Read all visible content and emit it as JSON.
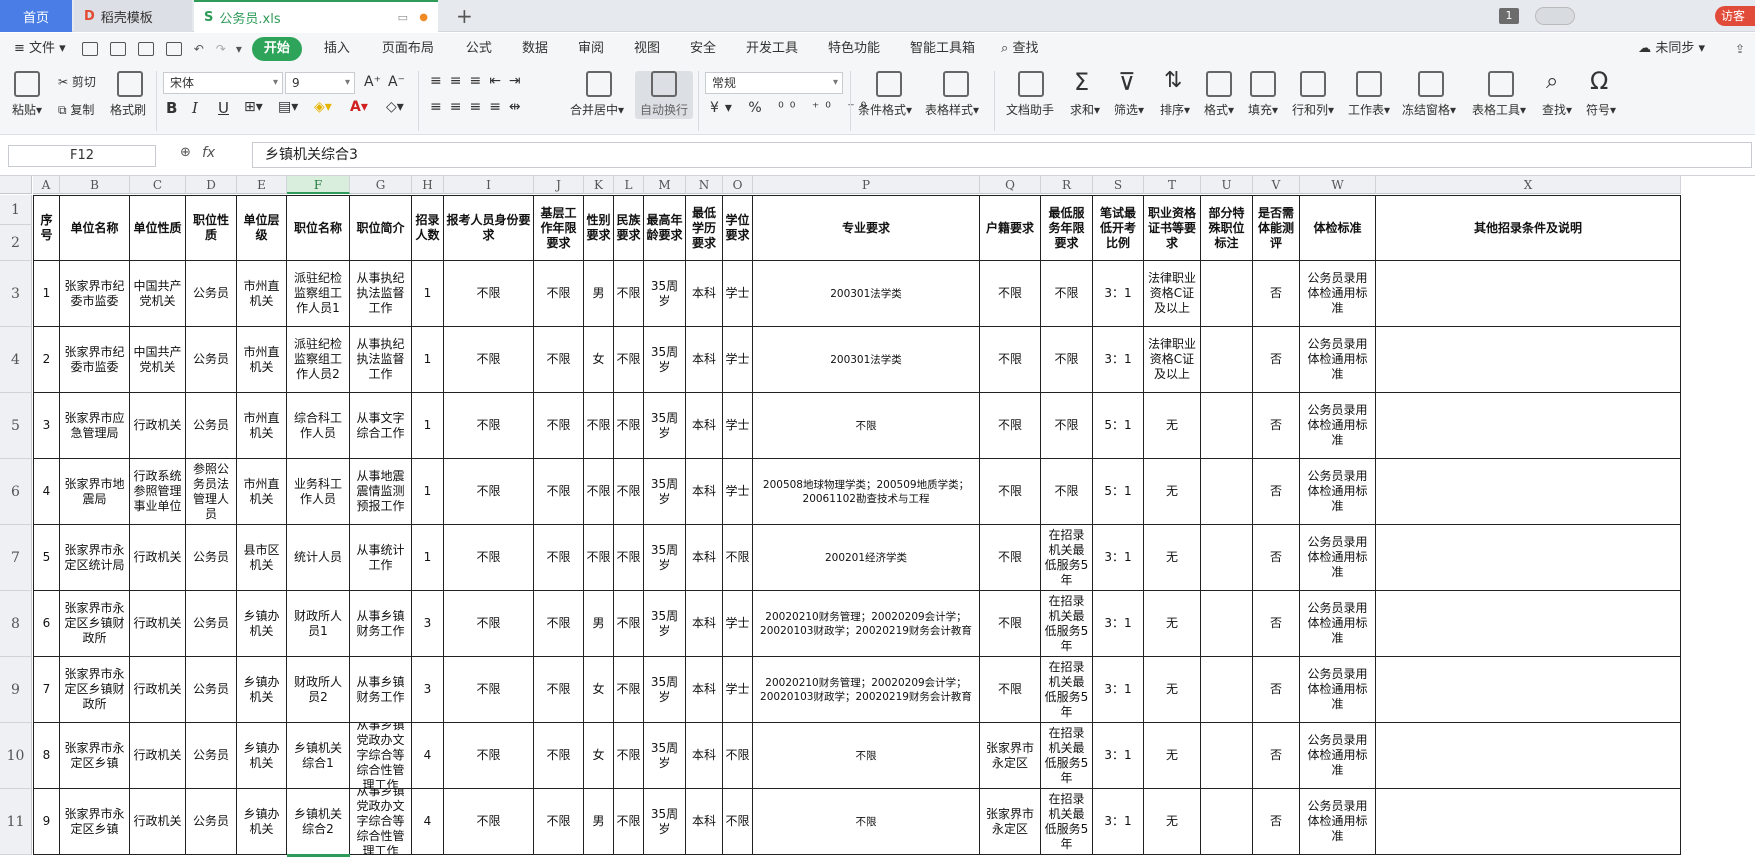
{
  "tabs": {
    "home": "首页",
    "template": "稻壳模板",
    "file": "公务员.xls",
    "badge": "1",
    "user": "访客"
  },
  "menu": {
    "file": "文件",
    "items": [
      "开始",
      "插入",
      "页面布局",
      "公式",
      "数据",
      "审阅",
      "视图",
      "安全",
      "开发工具",
      "特色功能",
      "智能工具箱"
    ],
    "search": "查找",
    "sync": "未同步"
  },
  "ribbon": {
    "paste": "粘贴",
    "cut": "剪切",
    "copy": "复制",
    "format_painter": "格式刷",
    "font": "宋体",
    "size": "9",
    "bold": "B",
    "italic": "I",
    "underline": "U",
    "merge": "合并居中",
    "wrap": "自动换行",
    "numformat": "常规",
    "groups": [
      "条件格式",
      "表格样式",
      "文档助手",
      "求和",
      "筛选",
      "排序",
      "格式",
      "填充",
      "行和列",
      "工作表",
      "冻结窗格",
      "表格工具",
      "查找",
      "符号"
    ]
  },
  "formula": {
    "namebox": "F12",
    "fx": "fx",
    "content": "乡镇机关综合3"
  },
  "columns": [
    "A",
    "B",
    "C",
    "D",
    "E",
    "F",
    "G",
    "H",
    "I",
    "J",
    "K",
    "L",
    "M",
    "N",
    "O",
    "P",
    "Q",
    "R",
    "S",
    "T",
    "U",
    "V",
    "W",
    "X"
  ],
  "selected_column": "F",
  "rows_labels": [
    "1",
    "2",
    "3",
    "4",
    "5",
    "6",
    "7",
    "8",
    "9",
    "10",
    "11"
  ],
  "headers": [
    "序号",
    "单位名称",
    "单位性质",
    "职位性质",
    "单位层级",
    "职位名称",
    "职位简介",
    "招录人数",
    "报考人员身份要求",
    "基层工作年限要求",
    "性别要求",
    "民族要求",
    "最高年龄要求",
    "最低学历要求",
    "学位要求",
    "专业要求",
    "户籍要求",
    "最低服务年限要求",
    "笔试最低开考比例",
    "职业资格证书等要求",
    "部分特殊职位标注",
    "是否需体能测评",
    "体检标准",
    "其他招录条件及说明"
  ],
  "records": [
    [
      "1",
      "张家界市纪委市监委",
      "中国共产党机关",
      "公务员",
      "市州直机关",
      "派驻纪检监察组工作人员1",
      "从事执纪执法监督工作",
      "1",
      "不限",
      "不限",
      "男",
      "不限",
      "35周岁",
      "本科",
      "学士",
      "200301法学类",
      "不限",
      "不限",
      "3：1",
      "法律职业资格C证及以上",
      "",
      "否",
      "公务员录用体检通用标准",
      ""
    ],
    [
      "2",
      "张家界市纪委市监委",
      "中国共产党机关",
      "公务员",
      "市州直机关",
      "派驻纪检监察组工作人员2",
      "从事执纪执法监督工作",
      "1",
      "不限",
      "不限",
      "女",
      "不限",
      "35周岁",
      "本科",
      "学士",
      "200301法学类",
      "不限",
      "不限",
      "3：1",
      "法律职业资格C证及以上",
      "",
      "否",
      "公务员录用体检通用标准",
      ""
    ],
    [
      "3",
      "张家界市应急管理局",
      "行政机关",
      "公务员",
      "市州直机关",
      "综合科工作人员",
      "从事文字综合工作",
      "1",
      "不限",
      "不限",
      "不限",
      "不限",
      "35周岁",
      "本科",
      "学士",
      "不限",
      "不限",
      "不限",
      "5：1",
      "无",
      "",
      "否",
      "公务员录用体检通用标准",
      ""
    ],
    [
      "4",
      "张家界市地震局",
      "行政系统参照管理事业单位",
      "参照公务员法管理人员",
      "市州直机关",
      "业务科工作人员",
      "从事地震震情监测预报工作",
      "1",
      "不限",
      "不限",
      "不限",
      "不限",
      "35周岁",
      "本科",
      "学士",
      "200508地球物理学类；200509地质学类；20061102勘查技术与工程",
      "不限",
      "不限",
      "5：1",
      "无",
      "",
      "否",
      "公务员录用体检通用标准",
      ""
    ],
    [
      "5",
      "张家界市永定区统计局",
      "行政机关",
      "公务员",
      "县市区机关",
      "统计人员",
      "从事统计工作",
      "1",
      "不限",
      "不限",
      "不限",
      "不限",
      "35周岁",
      "本科",
      "不限",
      "200201经济学类",
      "不限",
      "在招录机关最低服务5年",
      "3：1",
      "无",
      "",
      "否",
      "公务员录用体检通用标准",
      ""
    ],
    [
      "6",
      "张家界市永定区乡镇财政所",
      "行政机关",
      "公务员",
      "乡镇办机关",
      "财政所人员1",
      "从事乡镇财务工作",
      "3",
      "不限",
      "不限",
      "男",
      "不限",
      "35周岁",
      "本科",
      "学士",
      "20020210财务管理；20020209会计学；20020103财政学；20020219财务会计教育",
      "不限",
      "在招录机关最低服务5年",
      "3：1",
      "无",
      "",
      "否",
      "公务员录用体检通用标准",
      ""
    ],
    [
      "7",
      "张家界市永定区乡镇财政所",
      "行政机关",
      "公务员",
      "乡镇办机关",
      "财政所人员2",
      "从事乡镇财务工作",
      "3",
      "不限",
      "不限",
      "女",
      "不限",
      "35周岁",
      "本科",
      "学士",
      "20020210财务管理；20020209会计学；20020103财政学；20020219财务会计教育",
      "不限",
      "在招录机关最低服务5年",
      "3：1",
      "无",
      "",
      "否",
      "公务员录用体检通用标准",
      ""
    ],
    [
      "8",
      "张家界市永定区乡镇",
      "行政机关",
      "公务员",
      "乡镇办机关",
      "乡镇机关综合1",
      "从事乡镇党政办文字综合等综合性管理工作",
      "4",
      "不限",
      "不限",
      "女",
      "不限",
      "35周岁",
      "本科",
      "不限",
      "不限",
      "张家界市永定区",
      "在招录机关最低服务5年",
      "3：1",
      "无",
      "",
      "否",
      "公务员录用体检通用标准",
      ""
    ],
    [
      "9",
      "张家界市永定区乡镇",
      "行政机关",
      "公务员",
      "乡镇办机关",
      "乡镇机关综合2",
      "从事乡镇党政办文字综合等综合性管理工作",
      "4",
      "不限",
      "不限",
      "男",
      "不限",
      "35周岁",
      "本科",
      "不限",
      "不限",
      "张家界市永定区",
      "在招录机关最低服务5年",
      "3：1",
      "无",
      "",
      "否",
      "公务员录用体检通用标准",
      ""
    ]
  ]
}
